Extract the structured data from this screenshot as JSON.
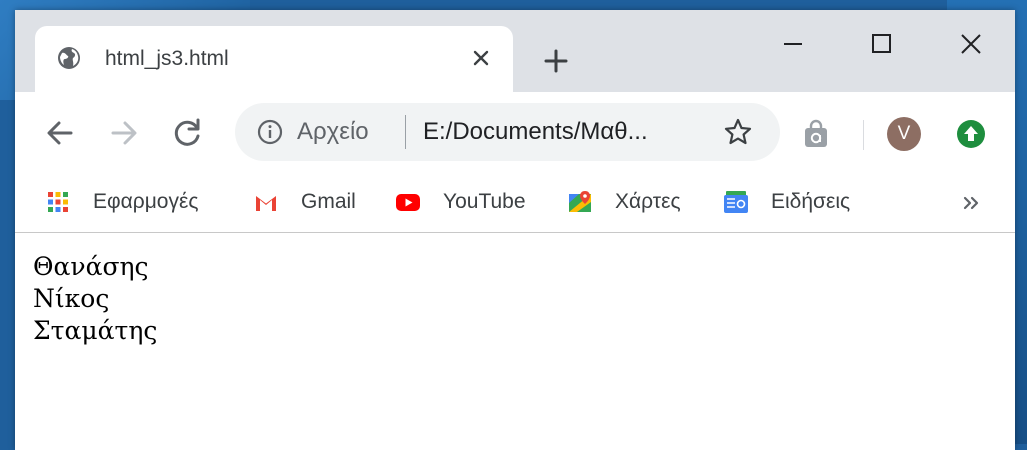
{
  "tab": {
    "title": "html_js3.html"
  },
  "toolbar": {
    "scheme_label": "Αρχείο",
    "url": "E:/Documents/Μαθ...",
    "avatar_letter": "V"
  },
  "bookmarks": {
    "items": [
      {
        "label": "Εφαρμογές"
      },
      {
        "label": "Gmail"
      },
      {
        "label": "YouTube"
      },
      {
        "label": "Χάρτες"
      },
      {
        "label": "Ειδήσεις"
      }
    ]
  },
  "page": {
    "names": [
      "Θανάσης",
      "Νίκος",
      "Σταμάτης"
    ]
  },
  "colors": {
    "tabstrip": "#dee1e6",
    "omnibox": "#f1f3f4",
    "avatar": "#8d6e63",
    "update": "#1e8e3e"
  }
}
